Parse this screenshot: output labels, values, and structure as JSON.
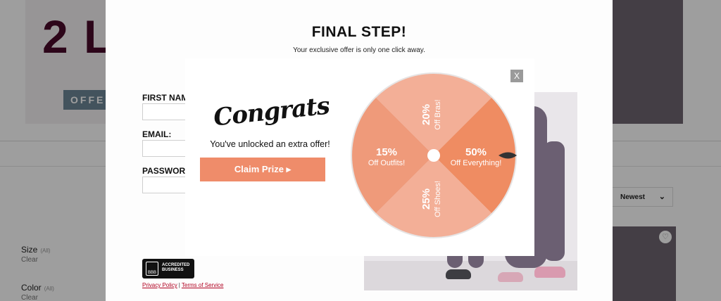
{
  "background": {
    "headline": "2 L",
    "offer_button": "OFFE",
    "filters": [
      {
        "label": "Size",
        "note": "(All)",
        "clear": "Clear"
      },
      {
        "label": "Color",
        "note": "(All)",
        "clear": "Clear"
      }
    ],
    "sort": {
      "value": "Newest",
      "icon": "chevron-down-icon"
    },
    "wishlist_icon": "heart-icon"
  },
  "form_modal": {
    "title": "FINAL STEP!",
    "subtitle": "Your exclusive offer is only one click away.",
    "fields": [
      {
        "label": "FIRST NAME:",
        "value": ""
      },
      {
        "label": "EMAIL:",
        "value": ""
      },
      {
        "label": "PASSWORD",
        "value": ""
      }
    ],
    "bbb": {
      "logo": "BBB",
      "line1": "ACCREDITED",
      "line2": "BUSINESS"
    },
    "privacy_link": "Privacy Policy",
    "separator": "|",
    "terms_link": "Terms of Service"
  },
  "prize_popup": {
    "close_label": "X",
    "heading": "Congrats",
    "message": "You've unlocked an extra offer!",
    "claim_button": "Claim Prize ▸",
    "wheel": {
      "segments": [
        {
          "pct": "20%",
          "text": "Off Bras!",
          "color": "#f3af97"
        },
        {
          "pct": "50%",
          "text": "Off Everything!",
          "color": "#ef8c62"
        },
        {
          "pct": "25%",
          "text": "Off Shoes!",
          "color": "#f3af97"
        },
        {
          "pct": "15%",
          "text": "Off Outfits!",
          "color": "#ef9a7a"
        }
      ],
      "rim_color": "#e6e4e4",
      "pointer_color": "#333333"
    }
  }
}
